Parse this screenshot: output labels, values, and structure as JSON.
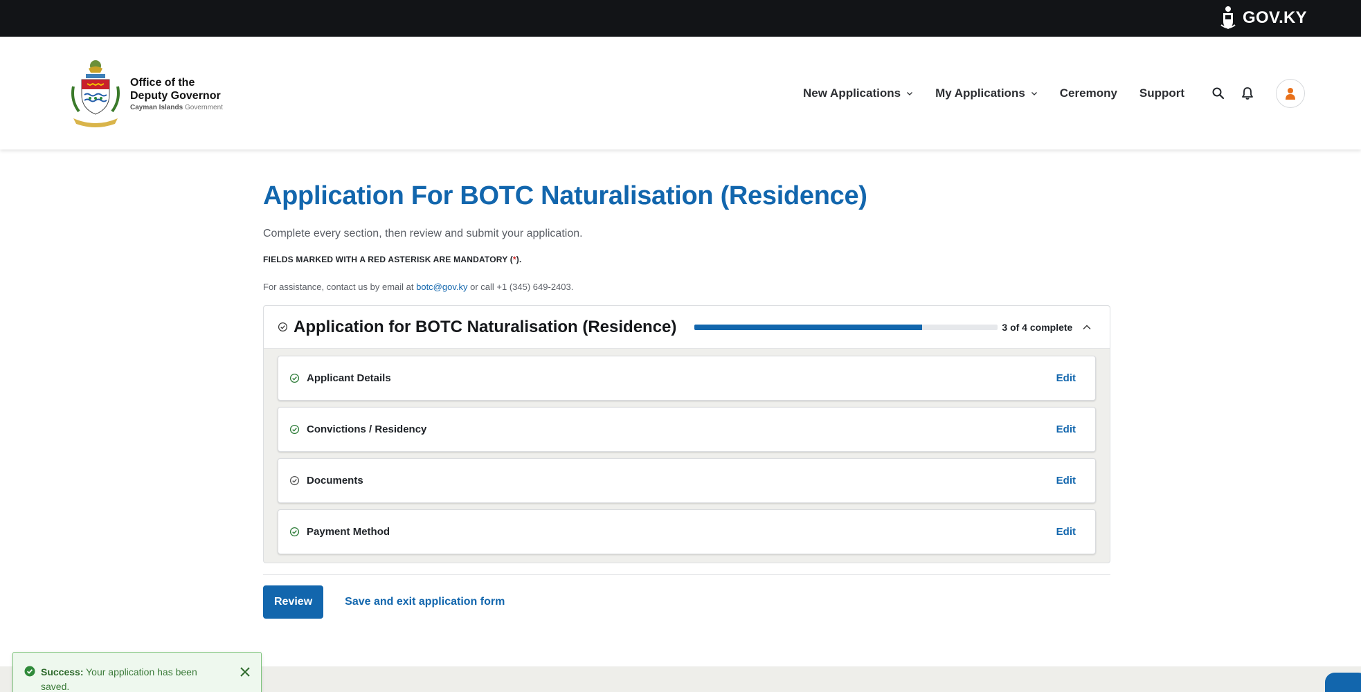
{
  "topbar": {
    "gov_label": "GOV.KY"
  },
  "header": {
    "brand": {
      "line1": "Office of the",
      "line2": "Deputy Governor",
      "sub_bold": "Cayman Islands",
      "sub_rest": "Government"
    },
    "nav": [
      {
        "label": "New Applications",
        "has_dropdown": true
      },
      {
        "label": "My Applications",
        "has_dropdown": true
      },
      {
        "label": "Ceremony",
        "has_dropdown": false
      },
      {
        "label": "Support",
        "has_dropdown": false
      }
    ],
    "icons": [
      "search-icon",
      "bell-icon",
      "user-icon"
    ]
  },
  "main": {
    "title": "Application For BOTC Naturalisation (Residence)",
    "intro": "Complete every section, then review and submit your application.",
    "mandatory_prefix": "FIELDS MARKED WITH A RED ASTERISK ARE MANDATORY (",
    "mandatory_asterisk": "*",
    "mandatory_suffix": ").",
    "assist_prefix": "For assistance, contact us by email at ",
    "assist_email": "botc@gov.ky",
    "assist_suffix": " or call +1 (345) 649-2403.",
    "panel": {
      "title": "Application for BOTC Naturalisation (Residence)",
      "progress_fraction": 0.75,
      "progress_text": "3 of 4 complete",
      "sections": [
        {
          "name": "Applicant Details",
          "action": "Edit"
        },
        {
          "name": "Convictions / Residency",
          "action": "Edit"
        },
        {
          "name": "Documents",
          "action": "Edit"
        },
        {
          "name": "Payment Method",
          "action": "Edit"
        }
      ]
    },
    "actions": {
      "review": "Review",
      "save_exit": "Save and exit application form"
    }
  },
  "toast": {
    "title": "Success:",
    "message": " Your application has been saved."
  },
  "colors": {
    "primary": "#1266ad",
    "success": "#3a7a38",
    "topbar": "#121417",
    "asterisk": "#cc2222",
    "avatar_icon": "#e8701a"
  }
}
